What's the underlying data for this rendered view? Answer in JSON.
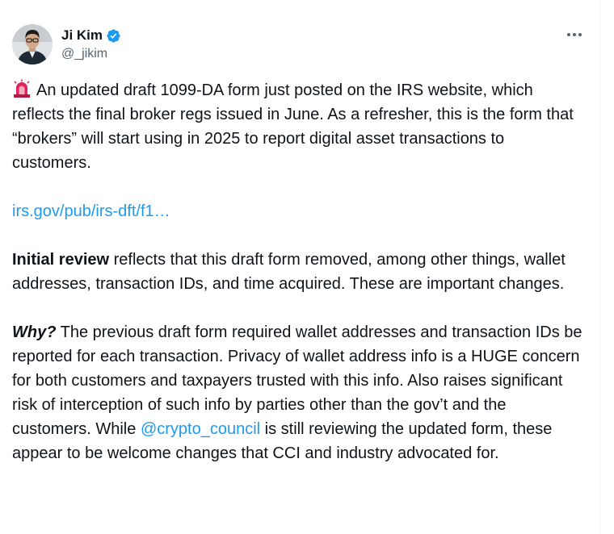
{
  "author": {
    "display_name": "Ji Kim",
    "handle": "@_jikim",
    "verified": true
  },
  "more_button": {
    "icon": "more-horizontal-icon",
    "label": "•••"
  },
  "tweet": {
    "p1": {
      "emoji": "siren-icon",
      "text": "An updated draft 1099-DA form just posted on the IRS website, which reflects the final broker regs issued in June. As a refresher, this is the form that “brokers” will start using in 2025 to report digital asset transactions to customers."
    },
    "link": "irs.gov/pub/irs-dft/f1…",
    "p2": {
      "bold": "Initial review",
      "text": " reflects that this draft form removed, among other things, wallet addresses, transaction IDs, and time acquired. These are important changes."
    },
    "p3": {
      "lead": "Why?",
      "text_before_mention": " The previous draft form required wallet addresses and transaction IDs be reported for each transaction. Privacy of wallet address info is a HUGE concern for both customers and taxpayers trusted with this info. Also raises significant risk of interception of such info by parties other than the gov’t and the customers. While ",
      "mention": "@crypto_council",
      "text_after_mention": " is still reviewing the updated form, these appear to be welcome changes that CCI and industry advocated for."
    }
  },
  "colors": {
    "text": "#0f1419",
    "secondary": "#536471",
    "link": "#1d9bf0",
    "verified": "#1d9bf0",
    "siren": "#e0245e"
  }
}
